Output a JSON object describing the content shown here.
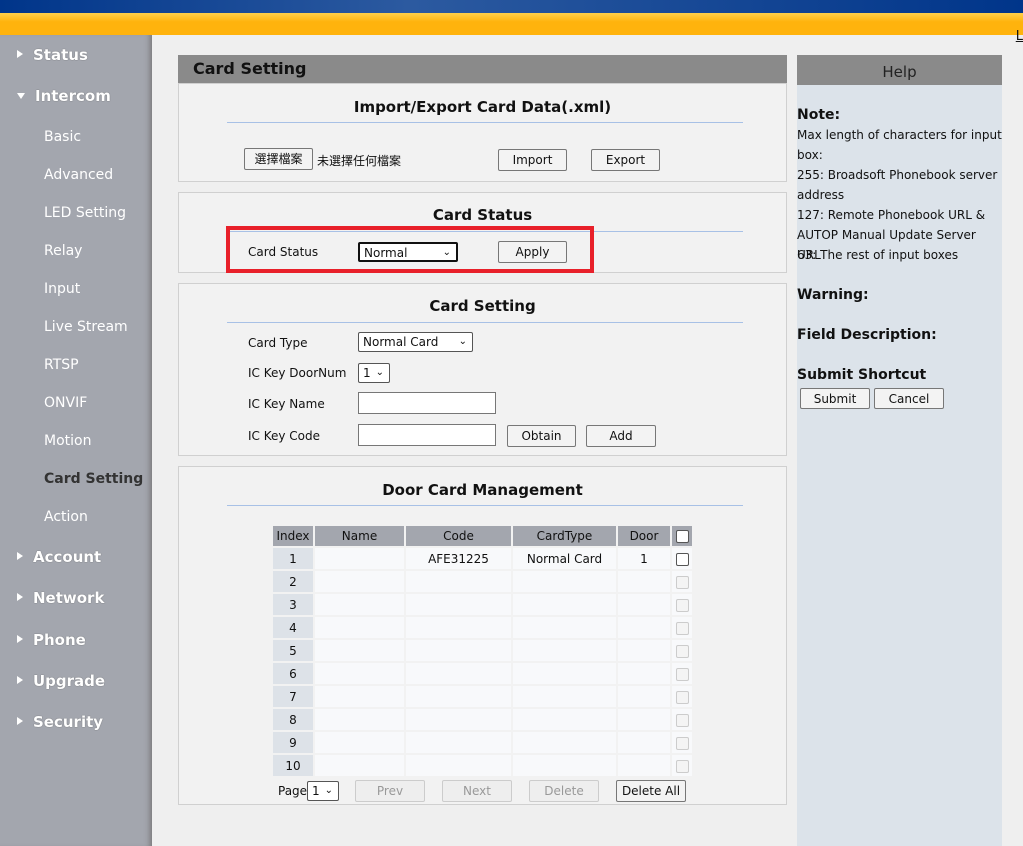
{
  "header": {
    "logout_partial": "L"
  },
  "sidebar": {
    "items": [
      {
        "label": "Status",
        "expanded": false
      },
      {
        "label": "Intercom",
        "expanded": true,
        "children": [
          "Basic",
          "Advanced",
          "LED Setting",
          "Relay",
          "Input",
          "Live Stream",
          "RTSP",
          "ONVIF",
          "Motion",
          "Card Setting",
          "Action"
        ],
        "active_child": "Card Setting"
      },
      {
        "label": "Account",
        "expanded": false
      },
      {
        "label": "Network",
        "expanded": false
      },
      {
        "label": "Phone",
        "expanded": false
      },
      {
        "label": "Upgrade",
        "expanded": false
      },
      {
        "label": "Security",
        "expanded": false
      }
    ]
  },
  "main": {
    "title": "Card Setting",
    "import_export": {
      "title": "Import/Export Card Data(.xml)",
      "choose_file": "選擇檔案",
      "no_file": "未選擇任何檔案",
      "import": "Import",
      "export": "Export"
    },
    "card_status": {
      "title": "Card Status",
      "label": "Card Status",
      "value": "Normal",
      "apply": "Apply",
      "highlight_color": "#e8202a"
    },
    "card_setting": {
      "title": "Card Setting",
      "card_type_label": "Card Type",
      "card_type_value": "Normal Card",
      "door_label": "IC Key DoorNum",
      "door_value": "1",
      "name_label": "IC Key Name",
      "name_value": "",
      "code_label": "IC Key Code",
      "code_value": "",
      "obtain": "Obtain",
      "add": "Add"
    },
    "management": {
      "title": "Door Card Management",
      "columns": [
        "Index",
        "Name",
        "Code",
        "CardType",
        "Door"
      ],
      "rows": [
        {
          "index": "1",
          "name": "",
          "code": "AFE31225",
          "type": "Normal Card",
          "door": "1"
        },
        {
          "index": "2"
        },
        {
          "index": "3"
        },
        {
          "index": "4"
        },
        {
          "index": "5"
        },
        {
          "index": "6"
        },
        {
          "index": "7"
        },
        {
          "index": "8"
        },
        {
          "index": "9"
        },
        {
          "index": "10"
        }
      ],
      "page_label": "Page",
      "page_value": "1",
      "prev": "Prev",
      "next": "Next",
      "delete": "Delete",
      "delete_all": "Delete All"
    }
  },
  "help": {
    "title": "Help",
    "note_title": "Note:",
    "note_lines": [
      "Max length of characters for input box:",
      "255: Broadsoft Phonebook server address",
      "127: Remote Phonebook URL & AUTOP Manual Update Server URL",
      "63: The rest of input boxes"
    ],
    "warning": "Warning:",
    "field_desc": "Field Description:",
    "shortcut": "Submit Shortcut",
    "submit": "Submit",
    "cancel": "Cancel"
  }
}
